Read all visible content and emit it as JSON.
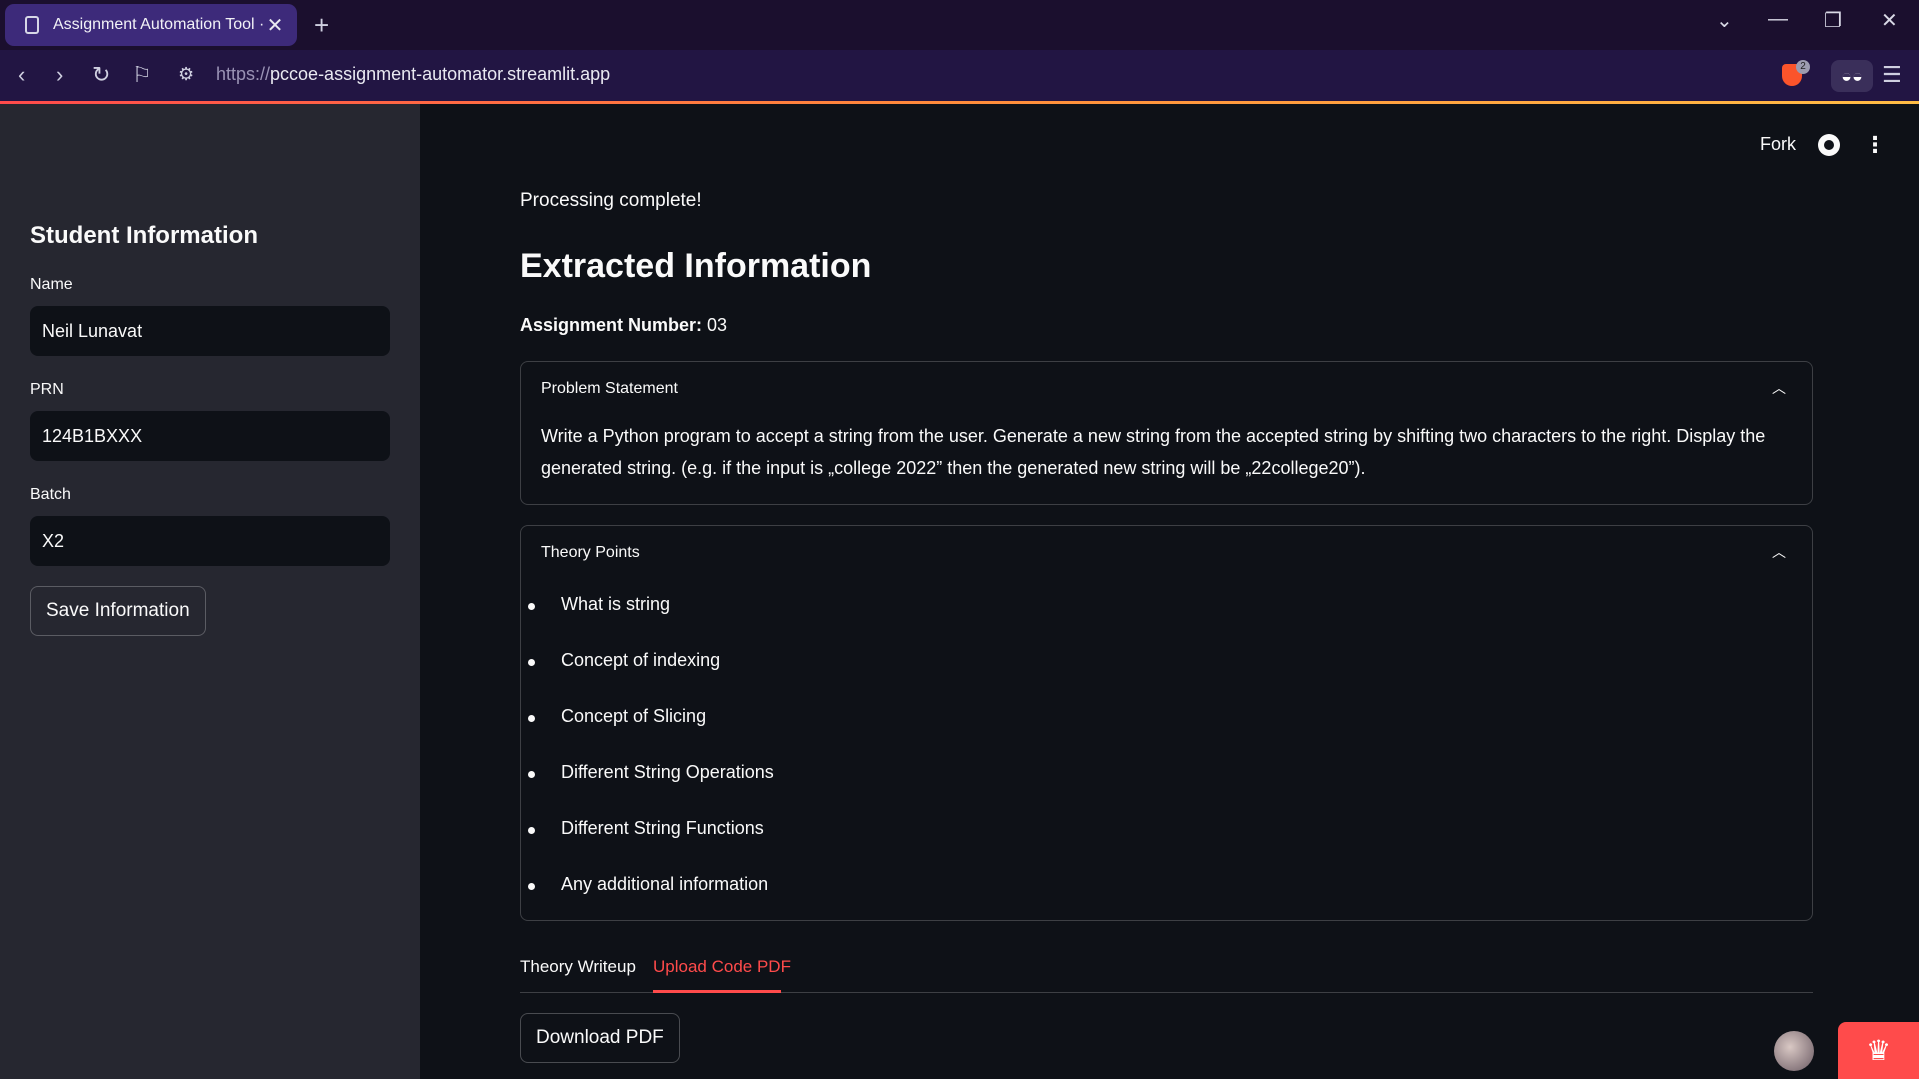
{
  "browser": {
    "tab_title": "Assignment Automation Tool · S",
    "url_protocol": "https://",
    "url_host": "pccoe-assignment-automator.streamlit.app",
    "brave_badge": "2",
    "icons": [
      "back-icon",
      "forward-icon",
      "reload-icon",
      "bookmark-icon",
      "site-settings-icon",
      "brave-shield-icon",
      "extension-icon",
      "menu-icon"
    ]
  },
  "sidebar": {
    "heading": "Student Information",
    "fields": [
      {
        "label": "Name",
        "value": "Neil Lunavat"
      },
      {
        "label": "PRN",
        "value": "124B1BXXX"
      },
      {
        "label": "Batch",
        "value": "X2"
      }
    ],
    "save_label": "Save Information"
  },
  "header": {
    "fork_label": "Fork"
  },
  "main": {
    "status": "Processing complete!",
    "title": "Extracted Information",
    "assignment_label": "Assignment Number:",
    "assignment_value": " 03",
    "problem": {
      "heading": "Problem Statement",
      "text": "Write a Python program to accept a string from the user. Generate a new string from the accepted string by shifting two characters to the right. Display the generated string. (e.g. if the input is „college 2022” then the generated new string will be „22college20”)."
    },
    "theory": {
      "heading": "Theory Points",
      "items": [
        "What is string",
        "Concept of indexing",
        "Concept of Slicing",
        "Different String Operations",
        "Different String Functions",
        "Any additional information"
      ]
    },
    "tabs": [
      "Theory Writeup",
      "Upload Code PDF"
    ],
    "download_label": "Download PDF"
  },
  "colors": {
    "accent": "#ff4b4b",
    "background": "#0e1117",
    "sidebar": "#262730"
  }
}
